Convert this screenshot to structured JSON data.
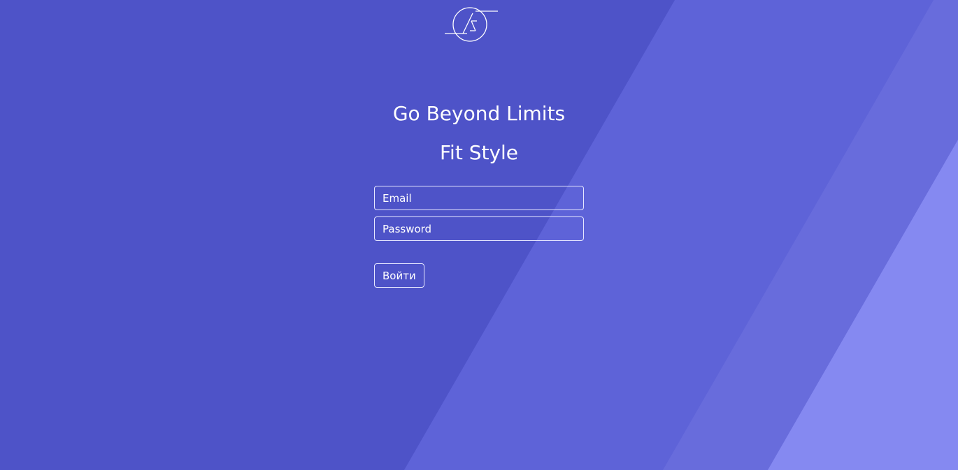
{
  "hero": {
    "title": "Go Beyond Limits",
    "subtitle": "Fit Style"
  },
  "login_form": {
    "email_placeholder": "Email",
    "password_placeholder": "Password",
    "submit_label": "Войти"
  },
  "icons": {
    "logo": "brand-logo-icon"
  },
  "colors": {
    "background": "#4e53c8",
    "stripe_1": "#5e63d8",
    "stripe_2": "#686cdc",
    "stripe_3": "#8589f1",
    "foreground": "#ffffff"
  }
}
